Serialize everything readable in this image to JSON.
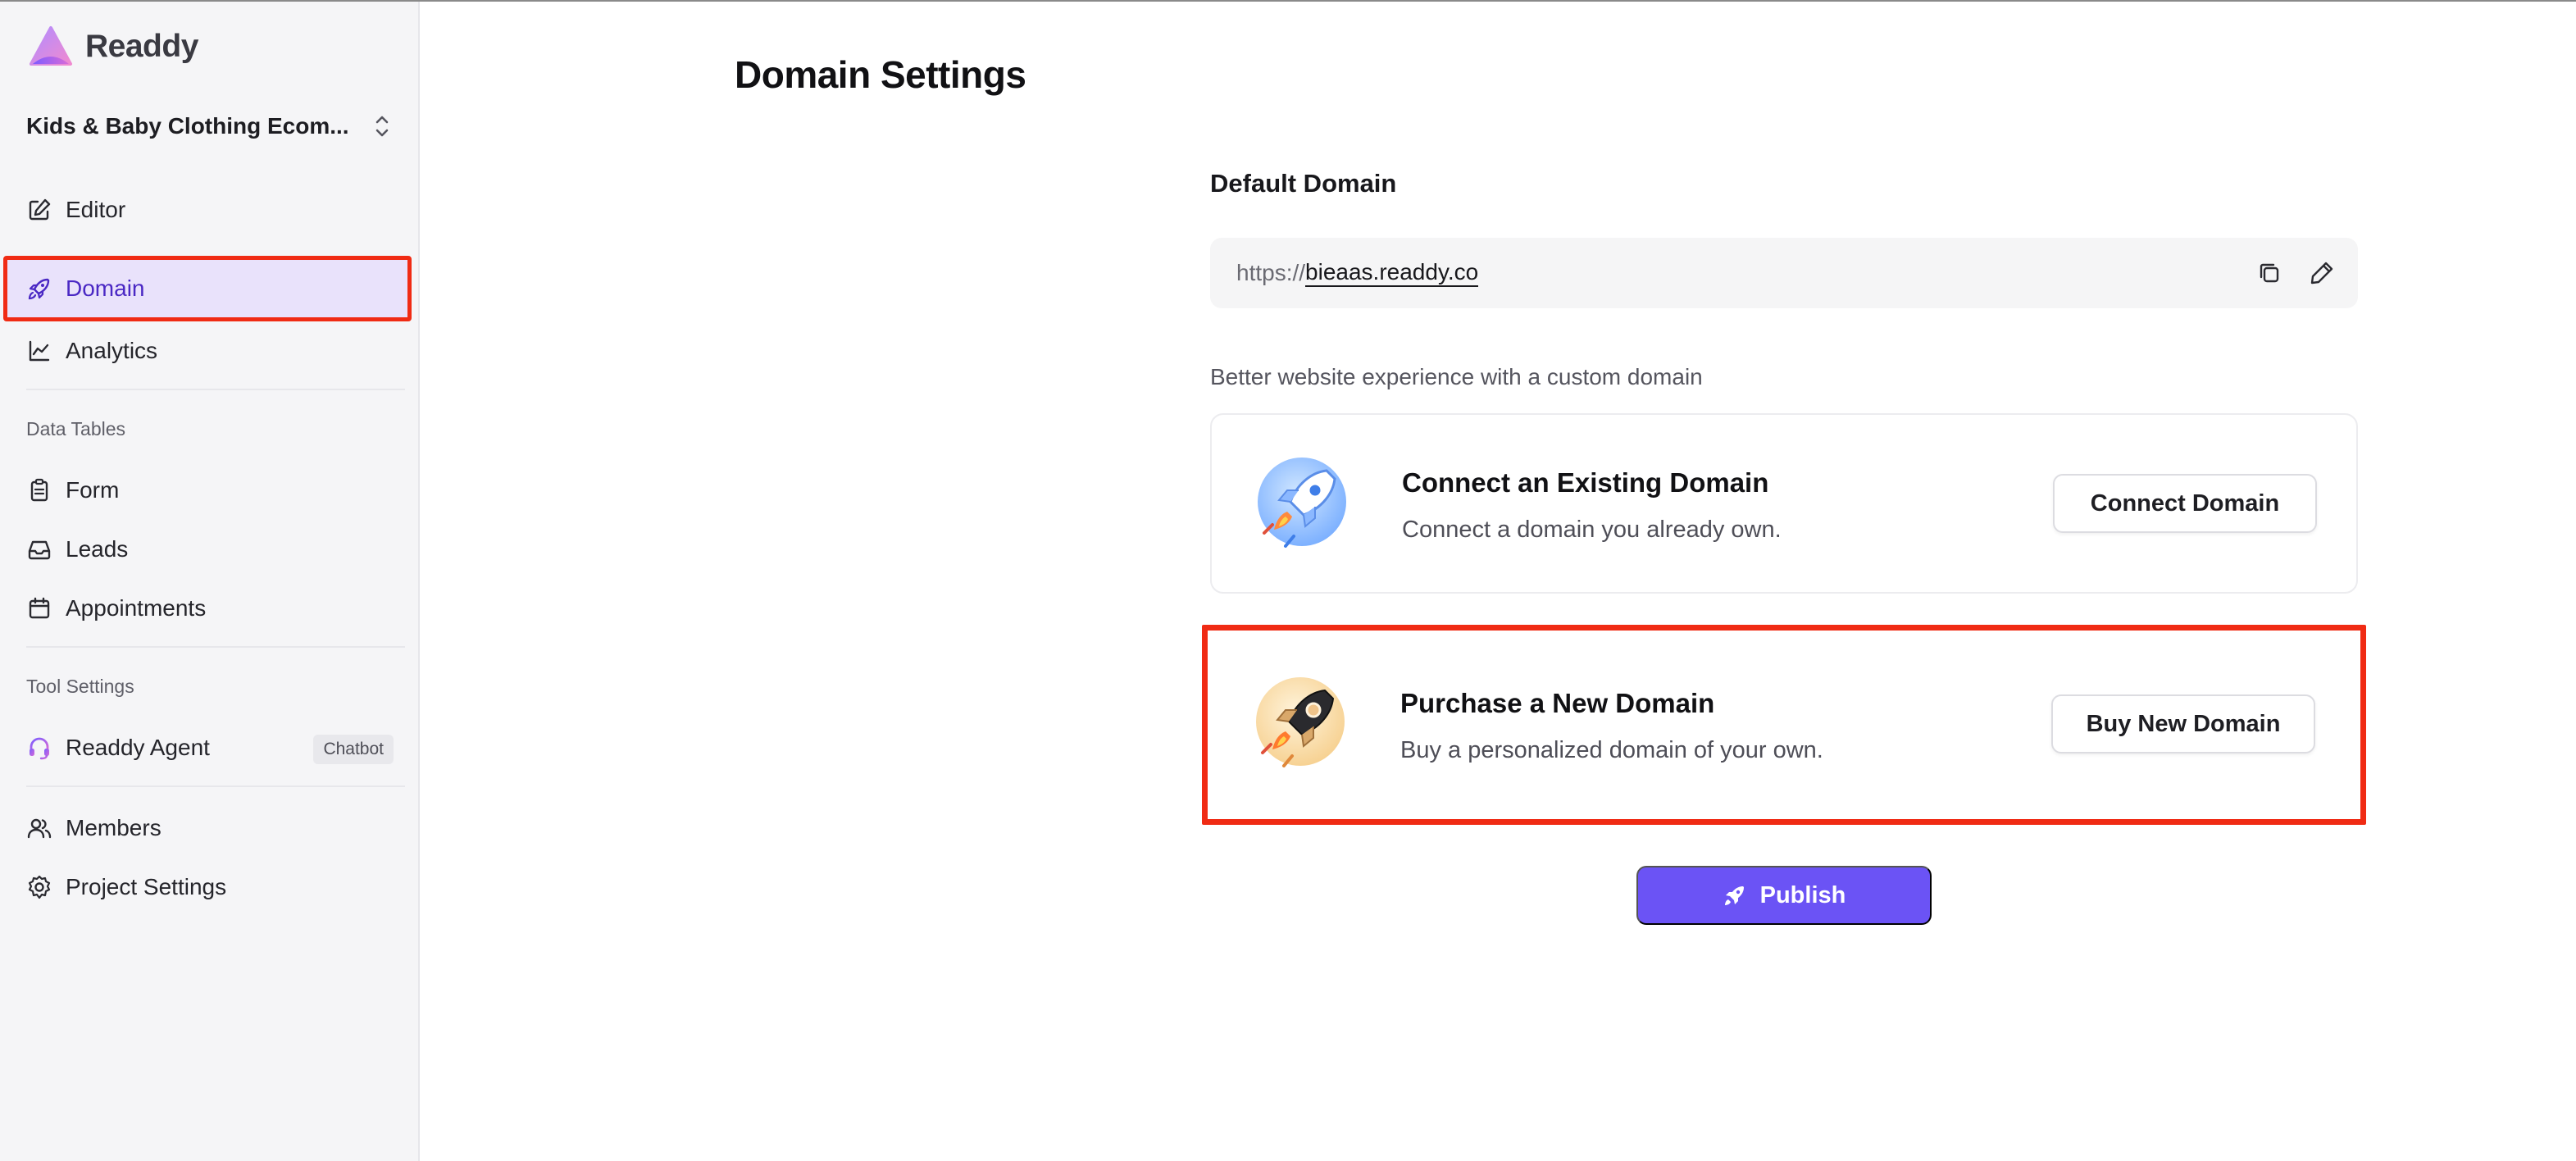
{
  "app": {
    "name": "Readdy"
  },
  "sidebar": {
    "project_name": "Kids & Baby Clothing Ecom...",
    "nav": {
      "editor": "Editor",
      "domain": "Domain",
      "analytics": "Analytics",
      "form": "Form",
      "leads": "Leads",
      "appointments": "Appointments",
      "readdy_agent": "Readdy Agent",
      "members": "Members",
      "project_settings": "Project Settings"
    },
    "sections": {
      "data_tables": "Data Tables",
      "tool_settings": "Tool Settings"
    },
    "chatbot_badge": "Chatbot"
  },
  "main": {
    "title": "Domain Settings",
    "default_domain": {
      "label": "Default Domain",
      "prefix": "https://",
      "value": "bieaas.readdy.co"
    },
    "hint": "Better website experience with a custom domain",
    "connect_card": {
      "title": "Connect an Existing Domain",
      "description": "Connect a domain you already own.",
      "button": "Connect Domain"
    },
    "purchase_card": {
      "title": "Purchase a New Domain",
      "description": "Buy a personalized domain of your own.",
      "button": "Buy New Domain"
    },
    "publish_button": "Publish"
  },
  "colors": {
    "accent": "#6b53f5",
    "active_nav_bg": "#e9e2fb",
    "highlight": "#f02b14"
  }
}
